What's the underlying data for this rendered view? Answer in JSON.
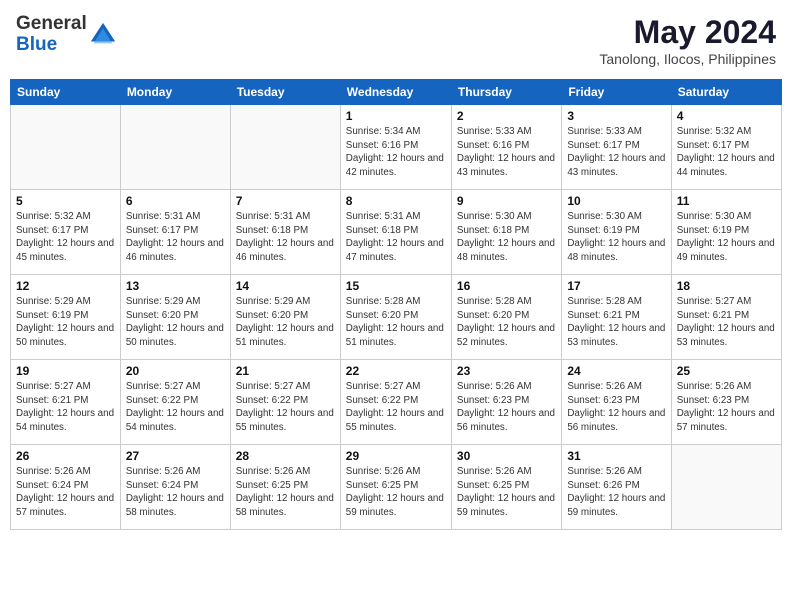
{
  "logo": {
    "general": "General",
    "blue": "Blue"
  },
  "title": {
    "month_year": "May 2024",
    "location": "Tanolong, Ilocos, Philippines"
  },
  "weekdays": [
    "Sunday",
    "Monday",
    "Tuesday",
    "Wednesday",
    "Thursday",
    "Friday",
    "Saturday"
  ],
  "weeks": [
    [
      {
        "day": "",
        "info": ""
      },
      {
        "day": "",
        "info": ""
      },
      {
        "day": "",
        "info": ""
      },
      {
        "day": "1",
        "info": "Sunrise: 5:34 AM\nSunset: 6:16 PM\nDaylight: 12 hours\nand 42 minutes."
      },
      {
        "day": "2",
        "info": "Sunrise: 5:33 AM\nSunset: 6:16 PM\nDaylight: 12 hours\nand 43 minutes."
      },
      {
        "day": "3",
        "info": "Sunrise: 5:33 AM\nSunset: 6:17 PM\nDaylight: 12 hours\nand 43 minutes."
      },
      {
        "day": "4",
        "info": "Sunrise: 5:32 AM\nSunset: 6:17 PM\nDaylight: 12 hours\nand 44 minutes."
      }
    ],
    [
      {
        "day": "5",
        "info": "Sunrise: 5:32 AM\nSunset: 6:17 PM\nDaylight: 12 hours\nand 45 minutes."
      },
      {
        "day": "6",
        "info": "Sunrise: 5:31 AM\nSunset: 6:17 PM\nDaylight: 12 hours\nand 46 minutes."
      },
      {
        "day": "7",
        "info": "Sunrise: 5:31 AM\nSunset: 6:18 PM\nDaylight: 12 hours\nand 46 minutes."
      },
      {
        "day": "8",
        "info": "Sunrise: 5:31 AM\nSunset: 6:18 PM\nDaylight: 12 hours\nand 47 minutes."
      },
      {
        "day": "9",
        "info": "Sunrise: 5:30 AM\nSunset: 6:18 PM\nDaylight: 12 hours\nand 48 minutes."
      },
      {
        "day": "10",
        "info": "Sunrise: 5:30 AM\nSunset: 6:19 PM\nDaylight: 12 hours\nand 48 minutes."
      },
      {
        "day": "11",
        "info": "Sunrise: 5:30 AM\nSunset: 6:19 PM\nDaylight: 12 hours\nand 49 minutes."
      }
    ],
    [
      {
        "day": "12",
        "info": "Sunrise: 5:29 AM\nSunset: 6:19 PM\nDaylight: 12 hours\nand 50 minutes."
      },
      {
        "day": "13",
        "info": "Sunrise: 5:29 AM\nSunset: 6:20 PM\nDaylight: 12 hours\nand 50 minutes."
      },
      {
        "day": "14",
        "info": "Sunrise: 5:29 AM\nSunset: 6:20 PM\nDaylight: 12 hours\nand 51 minutes."
      },
      {
        "day": "15",
        "info": "Sunrise: 5:28 AM\nSunset: 6:20 PM\nDaylight: 12 hours\nand 51 minutes."
      },
      {
        "day": "16",
        "info": "Sunrise: 5:28 AM\nSunset: 6:20 PM\nDaylight: 12 hours\nand 52 minutes."
      },
      {
        "day": "17",
        "info": "Sunrise: 5:28 AM\nSunset: 6:21 PM\nDaylight: 12 hours\nand 53 minutes."
      },
      {
        "day": "18",
        "info": "Sunrise: 5:27 AM\nSunset: 6:21 PM\nDaylight: 12 hours\nand 53 minutes."
      }
    ],
    [
      {
        "day": "19",
        "info": "Sunrise: 5:27 AM\nSunset: 6:21 PM\nDaylight: 12 hours\nand 54 minutes."
      },
      {
        "day": "20",
        "info": "Sunrise: 5:27 AM\nSunset: 6:22 PM\nDaylight: 12 hours\nand 54 minutes."
      },
      {
        "day": "21",
        "info": "Sunrise: 5:27 AM\nSunset: 6:22 PM\nDaylight: 12 hours\nand 55 minutes."
      },
      {
        "day": "22",
        "info": "Sunrise: 5:27 AM\nSunset: 6:22 PM\nDaylight: 12 hours\nand 55 minutes."
      },
      {
        "day": "23",
        "info": "Sunrise: 5:26 AM\nSunset: 6:23 PM\nDaylight: 12 hours\nand 56 minutes."
      },
      {
        "day": "24",
        "info": "Sunrise: 5:26 AM\nSunset: 6:23 PM\nDaylight: 12 hours\nand 56 minutes."
      },
      {
        "day": "25",
        "info": "Sunrise: 5:26 AM\nSunset: 6:23 PM\nDaylight: 12 hours\nand 57 minutes."
      }
    ],
    [
      {
        "day": "26",
        "info": "Sunrise: 5:26 AM\nSunset: 6:24 PM\nDaylight: 12 hours\nand 57 minutes."
      },
      {
        "day": "27",
        "info": "Sunrise: 5:26 AM\nSunset: 6:24 PM\nDaylight: 12 hours\nand 58 minutes."
      },
      {
        "day": "28",
        "info": "Sunrise: 5:26 AM\nSunset: 6:25 PM\nDaylight: 12 hours\nand 58 minutes."
      },
      {
        "day": "29",
        "info": "Sunrise: 5:26 AM\nSunset: 6:25 PM\nDaylight: 12 hours\nand 59 minutes."
      },
      {
        "day": "30",
        "info": "Sunrise: 5:26 AM\nSunset: 6:25 PM\nDaylight: 12 hours\nand 59 minutes."
      },
      {
        "day": "31",
        "info": "Sunrise: 5:26 AM\nSunset: 6:26 PM\nDaylight: 12 hours\nand 59 minutes."
      },
      {
        "day": "",
        "info": ""
      }
    ]
  ]
}
